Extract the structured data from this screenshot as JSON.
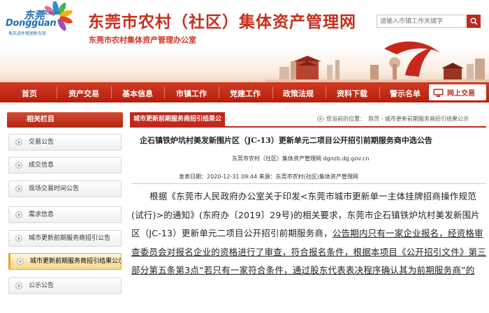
{
  "header": {
    "logo": {
      "cn": "东莞",
      "china": "CHINA",
      "en": "Dongguan",
      "slogan": "每天进步美丽新东莞"
    },
    "title": "东莞市农村（社区）集体资产管理网",
    "subtitle": "东莞市农村集体资产管理办公室",
    "search": {
      "placeholder": "请输入市镇工作关键字"
    }
  },
  "nav": {
    "items": [
      "首页",
      "资产交易",
      "基本信息",
      "市镇工作",
      "党建工作",
      "政策法规",
      "资料下载",
      "警示名单"
    ],
    "online_label": "网上交易"
  },
  "sidebar": {
    "heading": "相关栏目",
    "items": [
      {
        "label": "交易公告"
      },
      {
        "label": "成交信息"
      },
      {
        "label": "现场交易时间公告"
      },
      {
        "label": "需求信息"
      },
      {
        "label": "城市更新前期服务商招引公告"
      },
      {
        "label": "城市更新前期服务商招引结果公示"
      },
      {
        "label": "公示公告"
      }
    ]
  },
  "main": {
    "tab_label": "城市更新前期服务商招引结果公",
    "breadcrumb": {
      "prefix": "您当前的位置：",
      "path": "首页 - 城市更新前期服务商招引结果公示"
    },
    "article": {
      "title": "企石镇铁炉坑村美发新围片区（JC-13）更新单元二项目公开招引前期服务商中选公告",
      "source_line": "东莞市农村（社区）集体资产管理网    dgnzb.dg.gov.cn",
      "publish_line": "发表日期：2020-12-31 09:44    来源：东莞市农村(社区)集体资产管理网",
      "body": {
        "part1": "根据《东莞市人民政府办公室关于印发<东莞市城市更新单一主体挂牌招商操作规范(试行)>的通知》(东府办〔2019〕29号)的相关要求，东莞市企石镇铁炉坑村美发新围片区（JC-13）更新单元二项目公开招引前期服务商，",
        "part2": "公告期内只有一家企业报名，经资格审查委员会对报名企业的资格进行了审查，符合报名条件，根据本项目《公开招引文件》第三部分第五条第3点“若只有一家符合条件，通过股东代表表决程序确认其为前期服务商”的"
      }
    }
  },
  "colors": {
    "brand_red": "#c0281c",
    "active_item": "#f7d88a"
  }
}
